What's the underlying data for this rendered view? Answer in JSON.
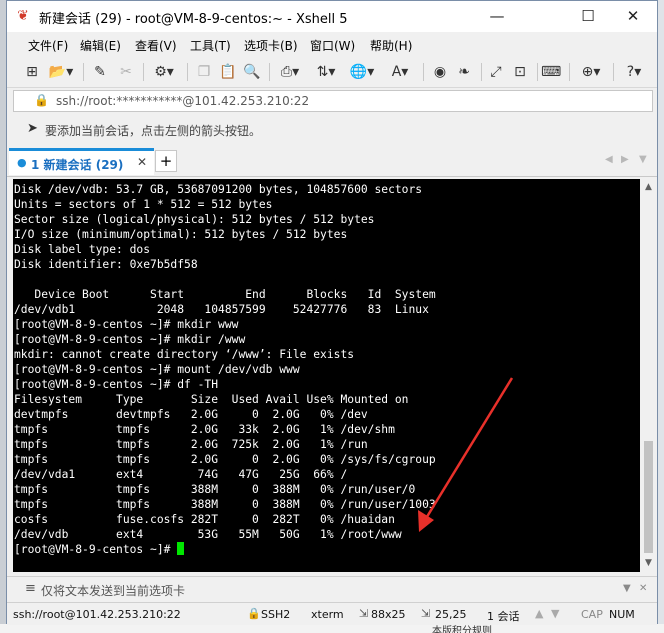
{
  "window": {
    "title": "新建会话 (29) - root@VM-8-9-centos:~ - Xshell 5",
    "minimize": "—",
    "maximize": "☐",
    "close": "✕"
  },
  "menu": {
    "items": [
      "文件(F)",
      "编辑(E)",
      "查看(V)",
      "工具(T)",
      "选项卡(B)",
      "窗口(W)",
      "帮助(H)"
    ]
  },
  "address": {
    "text": "ssh://root:***********@101.42.253.210:22"
  },
  "hint": {
    "text": "要添加当前会话，点击左侧的箭头按钮。"
  },
  "tabs": {
    "active_label": "1 新建会话 (29)",
    "close": "✕",
    "add": "+"
  },
  "terminal": {
    "lines": [
      "Disk /dev/vdb: 53.7 GB, 53687091200 bytes, 104857600 sectors",
      "Units = sectors of 1 * 512 = 512 bytes",
      "Sector size (logical/physical): 512 bytes / 512 bytes",
      "I/O size (minimum/optimal): 512 bytes / 512 bytes",
      "Disk label type: dos",
      "Disk identifier: 0xe7b5df58",
      "",
      "   Device Boot      Start         End      Blocks   Id  System",
      "/dev/vdb1            2048   104857599    52427776   83  Linux",
      "[root@VM-8-9-centos ~]# mkdir www",
      "[root@VM-8-9-centos ~]# mkdir /www",
      "mkdir: cannot create directory ‘/www’: File exists",
      "[root@VM-8-9-centos ~]# mount /dev/vdb www",
      "[root@VM-8-9-centos ~]# df -TH",
      "Filesystem     Type       Size  Used Avail Use% Mounted on",
      "devtmpfs       devtmpfs   2.0G     0  2.0G   0% /dev",
      "tmpfs          tmpfs      2.0G   33k  2.0G   1% /dev/shm",
      "tmpfs          tmpfs      2.0G  725k  2.0G   1% /run",
      "tmpfs          tmpfs      2.0G     0  2.0G   0% /sys/fs/cgroup",
      "/dev/vda1      ext4        74G   47G   25G  66% /",
      "tmpfs          tmpfs      388M     0  388M   0% /run/user/0",
      "tmpfs          tmpfs      388M     0  388M   0% /run/user/1003",
      "cosfs          fuse.cosfs 282T     0  282T   0% /huaidan",
      "/dev/vdb       ext4        53G   55M   50G   1% /root/www"
    ],
    "prompt": "[root@VM-8-9-centos ~]# "
  },
  "sendbar": {
    "text": "仅将文本发送到当前选项卡"
  },
  "status": {
    "connection": "ssh://root@101.42.253.210:22",
    "protocol": "SSH2",
    "terminal": "xterm",
    "size": "88x25",
    "cursor": "25,25",
    "sessions": "1 会话",
    "cap": "CAP",
    "num": "NUM"
  },
  "background": {
    "bottom_text": "本版积分规则"
  },
  "colors": {
    "accent": "#1a8cd8",
    "cursor": "#00e600",
    "annotation_arrow": "#e8302a"
  }
}
